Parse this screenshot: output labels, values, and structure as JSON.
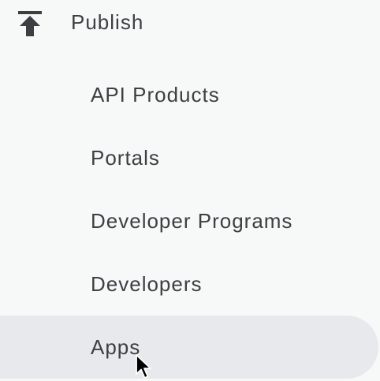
{
  "section": {
    "label": "Publish",
    "icon": "publish-upload-icon"
  },
  "items": [
    {
      "label": "API Products",
      "active": false
    },
    {
      "label": "Portals",
      "active": false
    },
    {
      "label": "Developer Programs",
      "active": false
    },
    {
      "label": "Developers",
      "active": false
    },
    {
      "label": "Apps",
      "active": true
    }
  ],
  "colors": {
    "background": "#f7f8f8",
    "active_background": "#e8e9ec",
    "text": "#3c4043"
  }
}
